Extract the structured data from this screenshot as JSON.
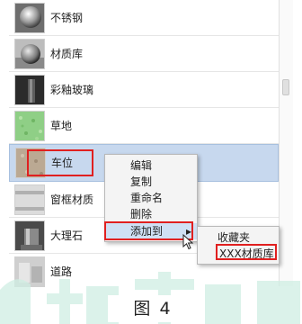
{
  "materials": [
    {
      "label": "不锈钢",
      "thumb": "steel-sphere"
    },
    {
      "label": "材质库",
      "thumb": "library-sphere"
    },
    {
      "label": "彩釉玻璃",
      "thumb": "glazed-glass"
    },
    {
      "label": "草地",
      "thumb": "grass-texture"
    },
    {
      "label": "车位",
      "thumb": "parking-space",
      "selected": true
    },
    {
      "label": "窗框材质",
      "thumb": "window-frame"
    },
    {
      "label": "大理石",
      "thumb": "marble"
    },
    {
      "label": "道路",
      "thumb": "road"
    }
  ],
  "context_menu": {
    "items": [
      "编辑",
      "复制",
      "重命名",
      "删除"
    ],
    "add_to": "添加到",
    "submenu_arrow": "▸"
  },
  "submenu": {
    "items": [
      "收藏夹",
      "XXX材质库"
    ]
  },
  "highlight_color": "#e02020",
  "caption": "图 4"
}
